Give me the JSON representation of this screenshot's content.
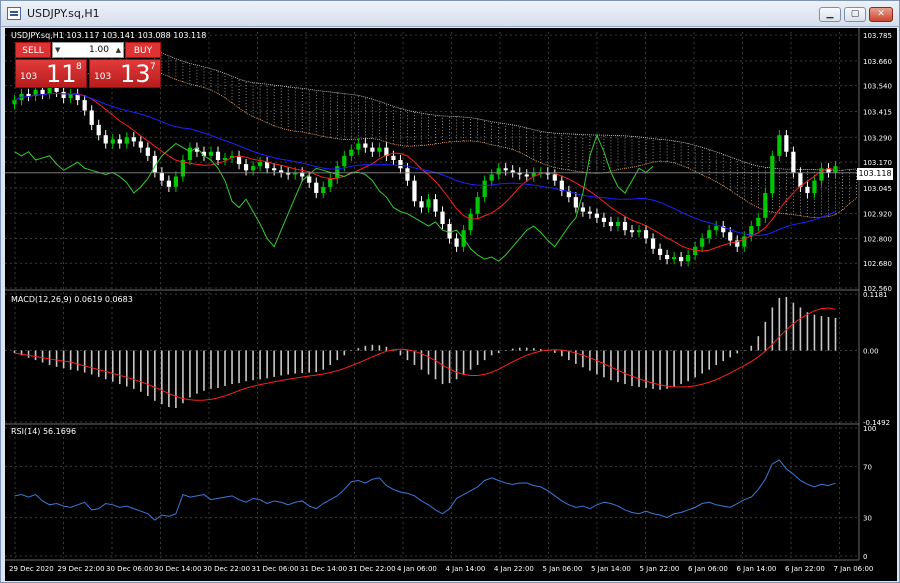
{
  "window": {
    "title": "USDJPY.sq,H1",
    "min_glyph": "▁",
    "max_glyph": "▢",
    "close_glyph": "✕"
  },
  "chart": {
    "header": "USDJPY.sq,H1 103.117 103.141 103.088 103.118",
    "current_price": "103.118",
    "price_ticks": [
      "103.785",
      "103.660",
      "103.540",
      "103.415",
      "103.290",
      "103.170",
      "103.045",
      "102.920",
      "102.800",
      "102.680",
      "102.560"
    ],
    "time_ticks": [
      "29 Dec 2020",
      "29 Dec 22:00",
      "30 Dec 06:00",
      "30 Dec 14:00",
      "30 Dec 22:00",
      "31 Dec 06:00",
      "31 Dec 14:00",
      "31 Dec 22:00",
      "4 Jan 06:00",
      "4 Jan 14:00",
      "4 Jan 22:00",
      "5 Jan 06:00",
      "5 Jan 14:00",
      "5 Jan 22:00",
      "6 Jan 06:00",
      "6 Jan 14:00",
      "6 Jan 22:00",
      "7 Jan 06:00"
    ],
    "colors": {
      "bull": "#00c800",
      "bear": "#ffffff",
      "grid": "#3a3a3a",
      "tenkan": "#ff2020",
      "kijun": "#2020ff",
      "chikou": "#32cd32",
      "span_a": "#f4a460",
      "span_b": "#dddddd"
    }
  },
  "trade_panel": {
    "sell_label": "SELL",
    "buy_label": "BUY",
    "volume": "1.00",
    "down_glyph": "▼",
    "up_glyph": "▲",
    "sell_small": "103",
    "sell_big": "11",
    "sell_sup": "8",
    "buy_small": "103",
    "buy_big": "13",
    "buy_sup": "7"
  },
  "macd": {
    "label": "MACD(12,26,9) 0.0619 0.0683",
    "ticks": [
      "0.1181",
      "0.00",
      "-0.1492"
    ],
    "colors": {
      "hist": "#c8c8c8",
      "signal": "#ff2020"
    }
  },
  "rsi": {
    "label": "RSI(14) 56.1696",
    "ticks": [
      "100",
      "70",
      "30",
      "0"
    ],
    "colors": {
      "line": "#3c78d8"
    }
  },
  "chart_data": [
    {
      "type": "candlestick",
      "title": "USDJPY.sq,H1",
      "ylim": [
        102.56,
        103.8
      ],
      "values": [
        103.47,
        103.5,
        103.49,
        103.52,
        103.5,
        103.53,
        103.51,
        103.48,
        103.5,
        103.47,
        103.42,
        103.35,
        103.3,
        103.26,
        103.28,
        103.26,
        103.29,
        103.27,
        103.24,
        103.2,
        103.12,
        103.08,
        103.05,
        103.1,
        103.18,
        103.24,
        103.22,
        103.2,
        103.22,
        103.18,
        103.19,
        103.2,
        103.16,
        103.13,
        103.15,
        103.17,
        103.14,
        103.13,
        103.12,
        103.11,
        103.12,
        103.1,
        103.07,
        103.02,
        103.05,
        103.09,
        103.15,
        103.2,
        103.23,
        103.26,
        103.24,
        103.22,
        103.24,
        103.2,
        103.18,
        103.14,
        103.08,
        102.98,
        102.95,
        102.99,
        102.93,
        102.87,
        102.8,
        102.76,
        102.84,
        102.92,
        103.0,
        103.08,
        103.11,
        103.14,
        103.13,
        103.12,
        103.11,
        103.1,
        103.12,
        103.12,
        103.11,
        103.08,
        103.03,
        103.0,
        102.95,
        102.93,
        102.92,
        102.9,
        102.88,
        102.86,
        102.88,
        102.84,
        102.83,
        102.84,
        102.8,
        102.75,
        102.72,
        102.7,
        102.71,
        102.69,
        102.72,
        102.76,
        102.8,
        102.84,
        102.86,
        102.83,
        102.79,
        102.76,
        102.81,
        102.86,
        102.9,
        103.02,
        103.2,
        103.3,
        103.22,
        103.12,
        103.05,
        103.02,
        103.08,
        103.14,
        103.12,
        103.15
      ]
    },
    {
      "type": "bar",
      "title": "MACD(12,26,9)",
      "ylim": [
        -0.1492,
        0.1181
      ],
      "values": [
        -0.005,
        -0.01,
        -0.015,
        -0.02,
        -0.025,
        -0.03,
        -0.034,
        -0.037,
        -0.04,
        -0.042,
        -0.046,
        -0.05,
        -0.055,
        -0.06,
        -0.065,
        -0.07,
        -0.075,
        -0.08,
        -0.086,
        -0.095,
        -0.105,
        -0.112,
        -0.118,
        -0.12,
        -0.11,
        -0.098,
        -0.09,
        -0.084,
        -0.08,
        -0.078,
        -0.074,
        -0.07,
        -0.068,
        -0.064,
        -0.062,
        -0.06,
        -0.058,
        -0.055,
        -0.052,
        -0.05,
        -0.048,
        -0.047,
        -0.046,
        -0.045,
        -0.04,
        -0.03,
        -0.02,
        -0.01,
        0.0,
        0.005,
        0.01,
        0.012,
        0.011,
        0.008,
        0.0,
        -0.01,
        -0.02,
        -0.03,
        -0.04,
        -0.05,
        -0.06,
        -0.07,
        -0.068,
        -0.06,
        -0.05,
        -0.04,
        -0.03,
        -0.02,
        -0.01,
        -0.005,
        0.0,
        0.004,
        0.006,
        0.006,
        0.005,
        0.003,
        0.0,
        -0.005,
        -0.012,
        -0.02,
        -0.028,
        -0.035,
        -0.042,
        -0.05,
        -0.056,
        -0.062,
        -0.066,
        -0.07,
        -0.074,
        -0.076,
        -0.078,
        -0.08,
        -0.082,
        -0.08,
        -0.076,
        -0.07,
        -0.064,
        -0.056,
        -0.048,
        -0.04,
        -0.03,
        -0.022,
        -0.014,
        -0.006,
        0.0,
        0.01,
        0.03,
        0.06,
        0.09,
        0.11,
        0.112,
        0.1,
        0.09,
        0.08,
        0.075,
        0.072,
        0.07,
        0.068
      ]
    },
    {
      "type": "line",
      "title": "RSI(14)",
      "ylim": [
        0,
        100
      ],
      "values": [
        47,
        48,
        46,
        48,
        43,
        40,
        41,
        39,
        38,
        40,
        42,
        36,
        37,
        41,
        40,
        38,
        39,
        37,
        35,
        33,
        28,
        32,
        31,
        33,
        48,
        46,
        47,
        48,
        44,
        45,
        46,
        47,
        44,
        42,
        45,
        44,
        41,
        43,
        42,
        40,
        42,
        43,
        39,
        37,
        41,
        44,
        47,
        52,
        58,
        59,
        57,
        60,
        61,
        55,
        52,
        50,
        49,
        47,
        43,
        40,
        36,
        33,
        37,
        45,
        48,
        51,
        54,
        59,
        61,
        59,
        57,
        56,
        57,
        57,
        55,
        54,
        51,
        47,
        43,
        40,
        38,
        39,
        37,
        40,
        42,
        41,
        39,
        36,
        34,
        33,
        35,
        33,
        32,
        30,
        33,
        34,
        36,
        38,
        41,
        42,
        40,
        39,
        38,
        41,
        44,
        46,
        52,
        60,
        72,
        75,
        68,
        64,
        59,
        56,
        54,
        56,
        55,
        57
      ]
    }
  ]
}
